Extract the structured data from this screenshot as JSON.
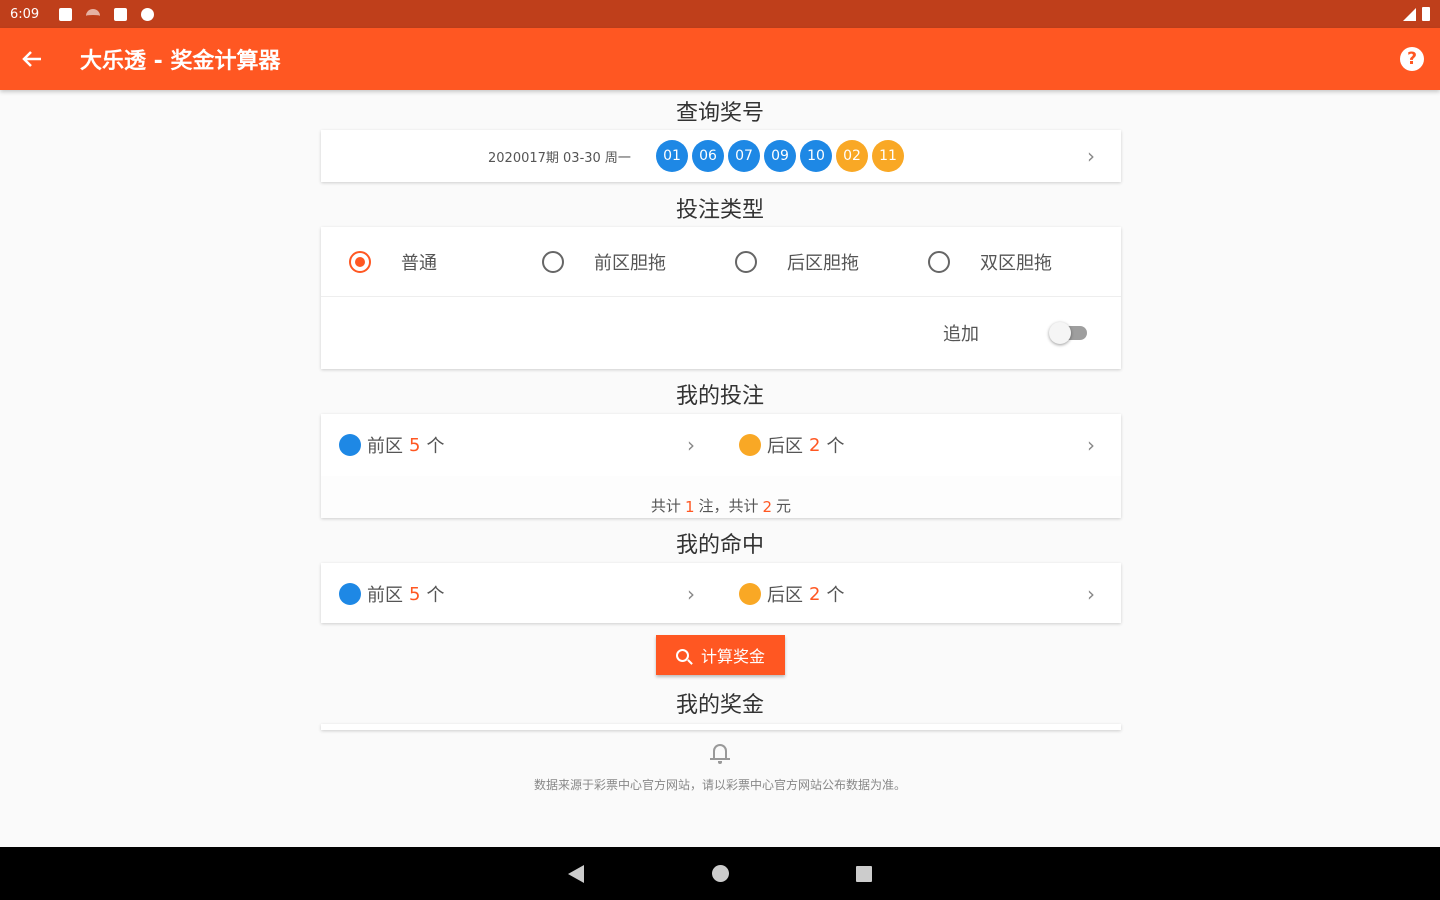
{
  "status_bar": {
    "time": "6:09"
  },
  "app_bar": {
    "title": "大乐透 - 奖金计算器",
    "help_symbol": "?"
  },
  "sections": {
    "query": "查询奖号",
    "bet_type": "投注类型",
    "my_bet": "我的投注",
    "my_hit": "我的命中",
    "my_prize": "我的奖金"
  },
  "draw": {
    "info": "2020017期 03-30 周一",
    "front_numbers": [
      "01",
      "06",
      "07",
      "09",
      "10"
    ],
    "back_numbers": [
      "02",
      "11"
    ],
    "colors": {
      "front": "#1e88e5",
      "back": "#f9a825"
    }
  },
  "bet_types": {
    "options": [
      "普通",
      "前区胆拖",
      "后区胆拖",
      "双区胆拖"
    ],
    "selected": "普通",
    "addon_label": "追加",
    "addon_enabled": false
  },
  "my_bet": {
    "front_label": "前区",
    "front_count": "5",
    "front_unit": "个",
    "back_label": "后区",
    "back_count": "2",
    "back_unit": "个",
    "total_prefix": "共计",
    "total_bets": "1",
    "total_mid": "注，共计",
    "total_amount": "2",
    "total_suffix": "元"
  },
  "my_hit": {
    "front_label": "前区",
    "front_count": "5",
    "front_unit": "个",
    "back_label": "后区",
    "back_count": "2",
    "back_unit": "个"
  },
  "calc_button": "计算奖金",
  "disclaimer": "数据来源于彩票中心官方网站，请以彩票中心官方网站公布数据为准。",
  "accent_color": "#ff5722"
}
